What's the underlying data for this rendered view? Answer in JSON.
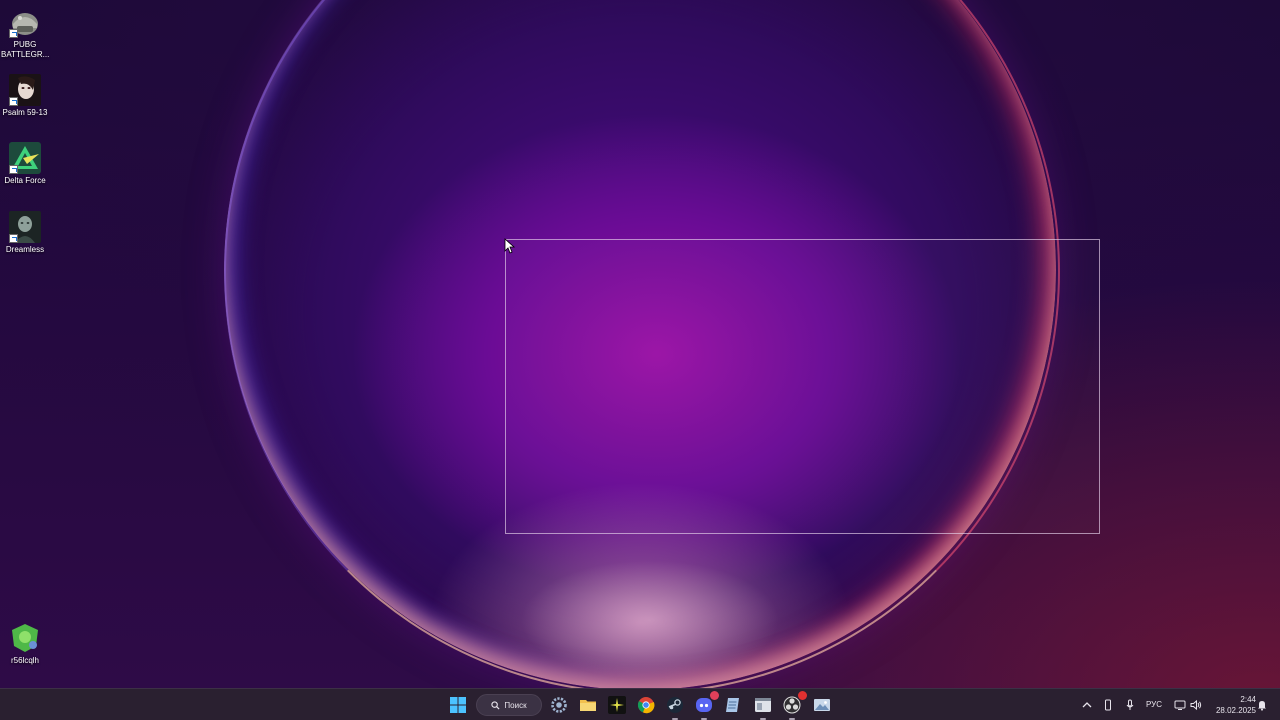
{
  "desktop": {
    "icons": [
      {
        "label": "PUBG BATTLEGR...",
        "icon": "pubg-helmet-icon"
      },
      {
        "label": "Psalm 59-13",
        "icon": "psalm-game-icon"
      },
      {
        "label": "Delta Force",
        "icon": "delta-force-icon"
      },
      {
        "label": "Dreamless",
        "icon": "dreamless-game-icon"
      },
      {
        "label": "r56lcqlh",
        "icon": "r56lcqlh-app-icon"
      }
    ]
  },
  "taskbar": {
    "search_label": "Поиск",
    "pinned_apps": [
      "windows-start-icon",
      "settings-gear-icon",
      "file-explorer-icon",
      "spark-app-icon",
      "chrome-icon",
      "steam-icon",
      "discord-icon",
      "notepad-icon",
      "window-app-icon",
      "obs-icon",
      "photos-icon"
    ],
    "tray": {
      "language": "РУС",
      "time": "2:44",
      "date": "28.02.2025"
    }
  },
  "colors": {
    "taskbar_bg": "#2a2030",
    "accent": "#4cc2ff",
    "wallpaper_glow": "#9a12a6"
  }
}
